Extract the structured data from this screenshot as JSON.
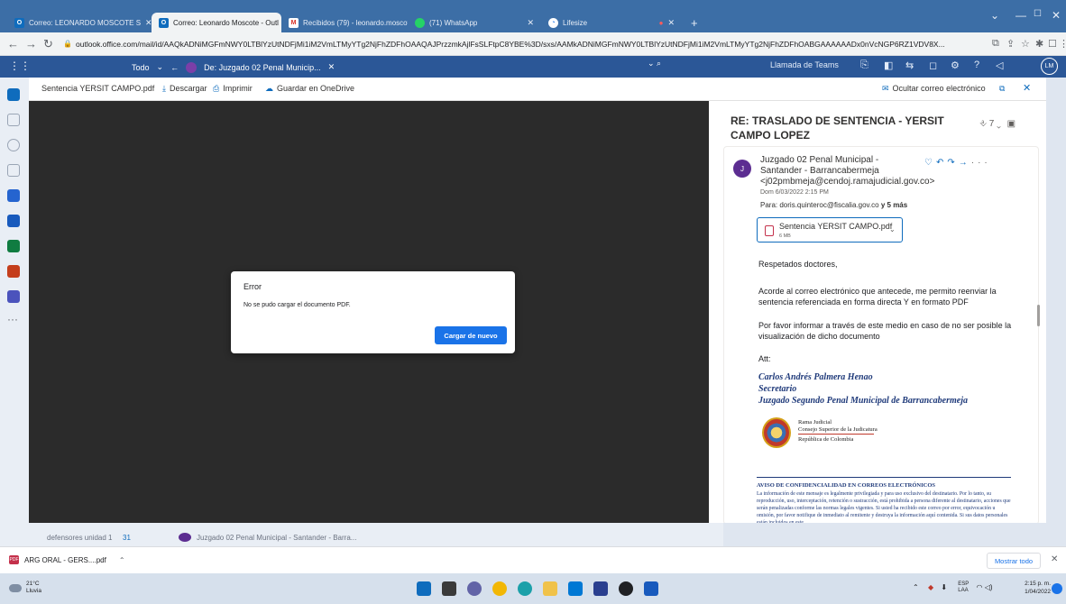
{
  "browser": {
    "tabs": [
      {
        "label": "Correo: LEONARDO MOSCOTE S",
        "icon": "outlook-icon",
        "active": false
      },
      {
        "label": "Correo: Leonardo Moscote - Outl",
        "icon": "outlook-icon",
        "active": true
      },
      {
        "label": "Recibidos (79) - leonardo.moscot",
        "icon": "gmail-icon",
        "active": false
      },
      {
        "label": "(71) WhatsApp",
        "icon": "whatsapp-icon",
        "active": false
      },
      {
        "label": "Lifesize",
        "icon": "lifesize-icon",
        "active": false
      }
    ],
    "url": "outlook.office.com/mail/id/AAQkADNiMGFmNWY0LTBlYzUtNDFjMi1iM2VmLTMyYTg2NjFhZDFhOAAQAJPrzzmkAjlFsSLFtpC8YBE%3D/sxs/AAMkADNiMGFmNWY0LTBlYzUtNDFjMi1iM2VmLTMyYTg2NjFhZDFhOABGAAAAAADx0nVcNGP6RZ1VDV8X...",
    "new_tab": "+"
  },
  "owa": {
    "filter_label": "Todo",
    "open_tab_label": "De: Juzgado 02 Penal Municip...",
    "teams_label": "Llamada de Teams",
    "avatar_initials": "LM"
  },
  "viewer": {
    "filename": "Sentencia YERSIT CAMPO.pdf",
    "download": "Descargar",
    "print": "Imprimir",
    "save_onedrive": "Guardar en OneDrive",
    "hide_email": "Ocultar correo electrónico"
  },
  "dialog": {
    "title": "Error",
    "message": "No se pudo cargar el documento PDF.",
    "button": "Cargar de nuevo"
  },
  "email": {
    "subject": "RE: TRASLADO DE SENTENCIA - YERSIT CAMPO LOPEZ",
    "thread_count": "7",
    "sender_initial": "J",
    "sender_name": "Juzgado 02 Penal Municipal - Santander - Barrancabermeja",
    "sender_email": "<j02pmbmeja@cendoj.ramajudicial.gov.co>",
    "date": "Dom 6/03/2022 2:15 PM",
    "to_prefix": "Para:",
    "to": "doris.quinteroc@fiscalia.gov.co",
    "to_more": "y 5 más",
    "attachment_name": "Sentencia YERSIT CAMPO.pdf",
    "attachment_size": "6 MB",
    "greeting": "Respetados doctores,",
    "para1": "Acorde al correo electrónico que antecede, me permito reenviar la sentencia referenciada en forma directa Y en formato PDF",
    "para2": "Por favor informar a través de este medio en caso de no ser posible la visualización de dicho documento",
    "att": "Att:",
    "sig_name": "Carlos Andrés Palmera Henao",
    "sig_role": "Secretario",
    "sig_office": "Juzgado Segundo Penal Municipal de Barrancabermeja",
    "logo_line1": "Rama Judicial",
    "logo_line2": "Consejo Superior de la Judicatura",
    "logo_line3": "República de Colombia",
    "conf_title": "AVISO DE CONFIDENCIALIDAD EN CORREOS ELECTRÓNICOS",
    "conf_text": "La información de este mensaje es legalmente privilegiada y para uso exclusivo del destinatario. Por lo tanto, su reproducción, uso, interceptación, retención o sustracción, está prohibida a persona diferente al destinatario, acciones que serán penalizadas conforme las normas legales vigentes. Si usted ha recibido este correo por error, equivocación u omisión, por favor notifique de inmediato al remitente y destruya la información aquí contenida. Si sus datos personales están incluidos en este"
  },
  "background_list": {
    "item1": "defensores unidad 1",
    "item1_count": "31",
    "item2": "Juzgado 02 Penal Municipal - Santander - Barra..."
  },
  "downloads": {
    "file": "ARG ORAL - GERS....pdf",
    "show_all": "Mostrar todo"
  },
  "taskbar": {
    "temp": "21°C",
    "weather": "Lluvia",
    "lang1": "ESP",
    "lang2": "LAA",
    "time": "2:15 p. m.",
    "date": "1/04/2022"
  }
}
